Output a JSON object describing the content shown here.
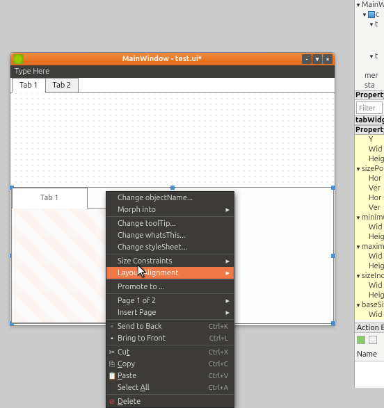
{
  "window": {
    "title": "MainWindow - test.ui*",
    "menu_placeholder": "Type Here"
  },
  "outer_tabs": [
    "Tab 1",
    "Tab 2"
  ],
  "inner_tabs": [
    "Tab 1"
  ],
  "context_menu": {
    "change_object_name": "Change objectName...",
    "morph_into": "Morph into",
    "change_tooltip": "Change toolTip...",
    "change_whatsthis": "Change whatsThis...",
    "change_stylesheet": "Change styleSheet...",
    "size_constraints": "Size Constraints",
    "layout_alignment": "Layout Alignment",
    "promote_to": "Promote to ...",
    "page_of": "Page 1 of 2",
    "insert_page": "Insert Page",
    "send_to_back": {
      "label": "Send to Back",
      "shortcut": "Ctrl+K"
    },
    "bring_to_front": {
      "label": "Bring to Front",
      "shortcut": "Ctrl+L"
    },
    "cut": {
      "label": "Cut",
      "shortcut": "Ctrl+X",
      "ul": "t"
    },
    "copy": {
      "label": "Copy",
      "shortcut": "Ctrl+C",
      "ul": "C"
    },
    "paste": {
      "label": "Paste",
      "shortcut": "Ctrl+V",
      "ul": "P"
    },
    "select_all": {
      "label": "Select All",
      "shortcut": "Ctrl+A",
      "ul": "A"
    },
    "delete": {
      "label": "Delete",
      "ul": "D"
    }
  },
  "right_panel": {
    "tree_root": "MainWin",
    "tree_c": "c",
    "tree_t": "t",
    "tree_mer": "mer",
    "tree_sta": "sta",
    "prop_editor_header": "Property E",
    "filter_placeholder": "Filter",
    "tabwidget_label": "tabWidge",
    "property_header": "Property",
    "rows": {
      "y": "Y",
      "wid": "Wid",
      "heig": "Heig",
      "sizepol": "sizePol",
      "hor": "Hor",
      "ver": "Ver",
      "hor2": "Hor",
      "ver2": "Ver",
      "minimu": "minimu",
      "wid2": "Wid",
      "heig2": "Heig",
      "maxim": "maxim",
      "wid3": "Wid",
      "heig3": "Heig",
      "sizeinc": "sizeInc",
      "wid4": "Wid",
      "heig4": "Heig",
      "basesi": "baseSiz",
      "wid5": "Wid"
    },
    "action_editor_header": "Action Edi",
    "name_col": "Name"
  }
}
